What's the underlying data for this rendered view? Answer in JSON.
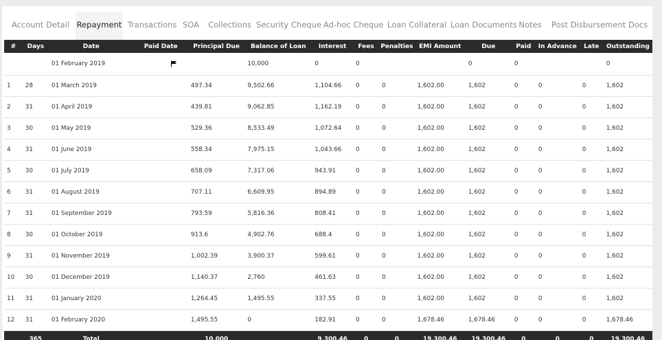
{
  "tabs": [
    {
      "label": "Account Detail",
      "active": false
    },
    {
      "label": "Repayment",
      "active": true
    },
    {
      "label": "Transactions",
      "active": false
    },
    {
      "label": "SOA",
      "active": false
    },
    {
      "label": "Collections",
      "active": false
    },
    {
      "label": "Security Cheque",
      "active": false
    },
    {
      "label": "Ad-hoc Cheque",
      "active": false
    },
    {
      "label": "Loan Collateral",
      "active": false
    },
    {
      "label": "Loan Documents",
      "active": false
    },
    {
      "label": "Notes",
      "active": false
    },
    {
      "label": "Post Disbursement Docs",
      "active": false
    }
  ],
  "table": {
    "headers": [
      "#",
      "Days",
      "Date",
      "Paid Date",
      "Principal Due",
      "Balance of Loan",
      "Interest",
      "Fees",
      "Penalties",
      "EMI Amount",
      "Due",
      "Paid",
      "In Advance",
      "Late",
      "Outstanding"
    ],
    "rows": [
      [
        "",
        "",
        "01 February 2019",
        "flag",
        "",
        "10,000",
        "0",
        "0",
        "",
        "",
        "0",
        "0",
        "",
        "",
        "0"
      ],
      [
        "1",
        "28",
        "01 March 2019",
        "",
        "497.34",
        "9,502.66",
        "1,104.66",
        "0",
        "0",
        "1,602.00",
        "1,602",
        "0",
        "0",
        "0",
        "1,602"
      ],
      [
        "2",
        "31",
        "01 April 2019",
        "",
        "439.81",
        "9,062.85",
        "1,162.19",
        "0",
        "0",
        "1,602.00",
        "1,602",
        "0",
        "0",
        "0",
        "1,602"
      ],
      [
        "3",
        "30",
        "01 May 2019",
        "",
        "529.36",
        "8,533.49",
        "1,072.64",
        "0",
        "0",
        "1,602.00",
        "1,602",
        "0",
        "0",
        "0",
        "1,602"
      ],
      [
        "4",
        "31",
        "01 June 2019",
        "",
        "558.34",
        "7,975.15",
        "1,043.66",
        "0",
        "0",
        "1,602.00",
        "1,602",
        "0",
        "0",
        "0",
        "1,602"
      ],
      [
        "5",
        "30",
        "01 July 2019",
        "",
        "658.09",
        "7,317.06",
        "943.91",
        "0",
        "0",
        "1,602.00",
        "1,602",
        "0",
        "0",
        "0",
        "1,602"
      ],
      [
        "6",
        "31",
        "01 August 2019",
        "",
        "707.11",
        "6,609.95",
        "894.89",
        "0",
        "0",
        "1,602.00",
        "1,602",
        "0",
        "0",
        "0",
        "1,602"
      ],
      [
        "7",
        "31",
        "01 September 2019",
        "",
        "793.59",
        "5,816.36",
        "808.41",
        "0",
        "0",
        "1,602.00",
        "1,602",
        "0",
        "0",
        "0",
        "1,602"
      ],
      [
        "8",
        "30",
        "01 October 2019",
        "",
        "913.6",
        "4,902.76",
        "688.4",
        "0",
        "0",
        "1,602.00",
        "1,602",
        "0",
        "0",
        "0",
        "1,602"
      ],
      [
        "9",
        "31",
        "01 November 2019",
        "",
        "1,002.39",
        "3,900.37",
        "599.61",
        "0",
        "0",
        "1,602.00",
        "1,602",
        "0",
        "0",
        "0",
        "1,602"
      ],
      [
        "10",
        "30",
        "01 December 2019",
        "",
        "1,140.37",
        "2,760",
        "461.63",
        "0",
        "0",
        "1,602.00",
        "1,602",
        "0",
        "0",
        "0",
        "1,602"
      ],
      [
        "11",
        "31",
        "01 January 2020",
        "",
        "1,264.45",
        "1,495.55",
        "337.55",
        "0",
        "0",
        "1,602.00",
        "1,602",
        "0",
        "0",
        "0",
        "1,602"
      ],
      [
        "12",
        "31",
        "01 February 2020",
        "",
        "1,495.55",
        "0",
        "182.91",
        "0",
        "0",
        "1,678.46",
        "1,678.46",
        "0",
        "0",
        "0",
        "1,678.46"
      ]
    ],
    "footer": [
      "",
      "365",
      "Total",
      "",
      "10,000",
      "",
      "9,300.46",
      "0",
      "0",
      "19,300.46",
      "19,300.46",
      "0",
      "0",
      "0",
      "19,300.46"
    ]
  },
  "icons": {
    "paid_date_marker": "flag-icon"
  },
  "colors": {
    "header_bg": "#2b2b2b",
    "header_text": "#ffffff",
    "page_bg": "#ececec"
  }
}
